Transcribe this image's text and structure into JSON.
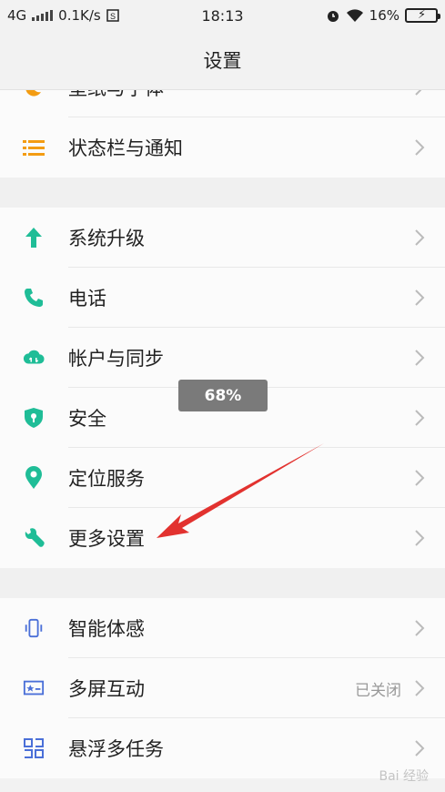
{
  "status_bar": {
    "network": "4G",
    "speed": "0.1K/s",
    "time": "18:13",
    "battery": "16%"
  },
  "header": {
    "title": "设置"
  },
  "rows": {
    "partial": {
      "label": "壁纸与字体"
    },
    "notification": {
      "label": "状态栏与通知"
    },
    "system_update": {
      "label": "系统升级"
    },
    "phone": {
      "label": "电话"
    },
    "accounts": {
      "label": "帐户与同步"
    },
    "security": {
      "label": "安全"
    },
    "location": {
      "label": "定位服务"
    },
    "more_settings": {
      "label": "更多设置"
    },
    "smart_motion": {
      "label": "智能体感"
    },
    "multi_screen": {
      "label": "多屏互动",
      "value": "已关闭"
    },
    "floating_tasks": {
      "label": "悬浮多任务"
    }
  },
  "toast": {
    "text": "68%"
  },
  "colors": {
    "orange": "#f39c12",
    "teal": "#1fbd97",
    "blue": "#4a6fd8",
    "arrow": "#e2322f",
    "toast_bg": "#7a7a7a"
  },
  "watermark": {
    "text": "Bai 经验"
  }
}
